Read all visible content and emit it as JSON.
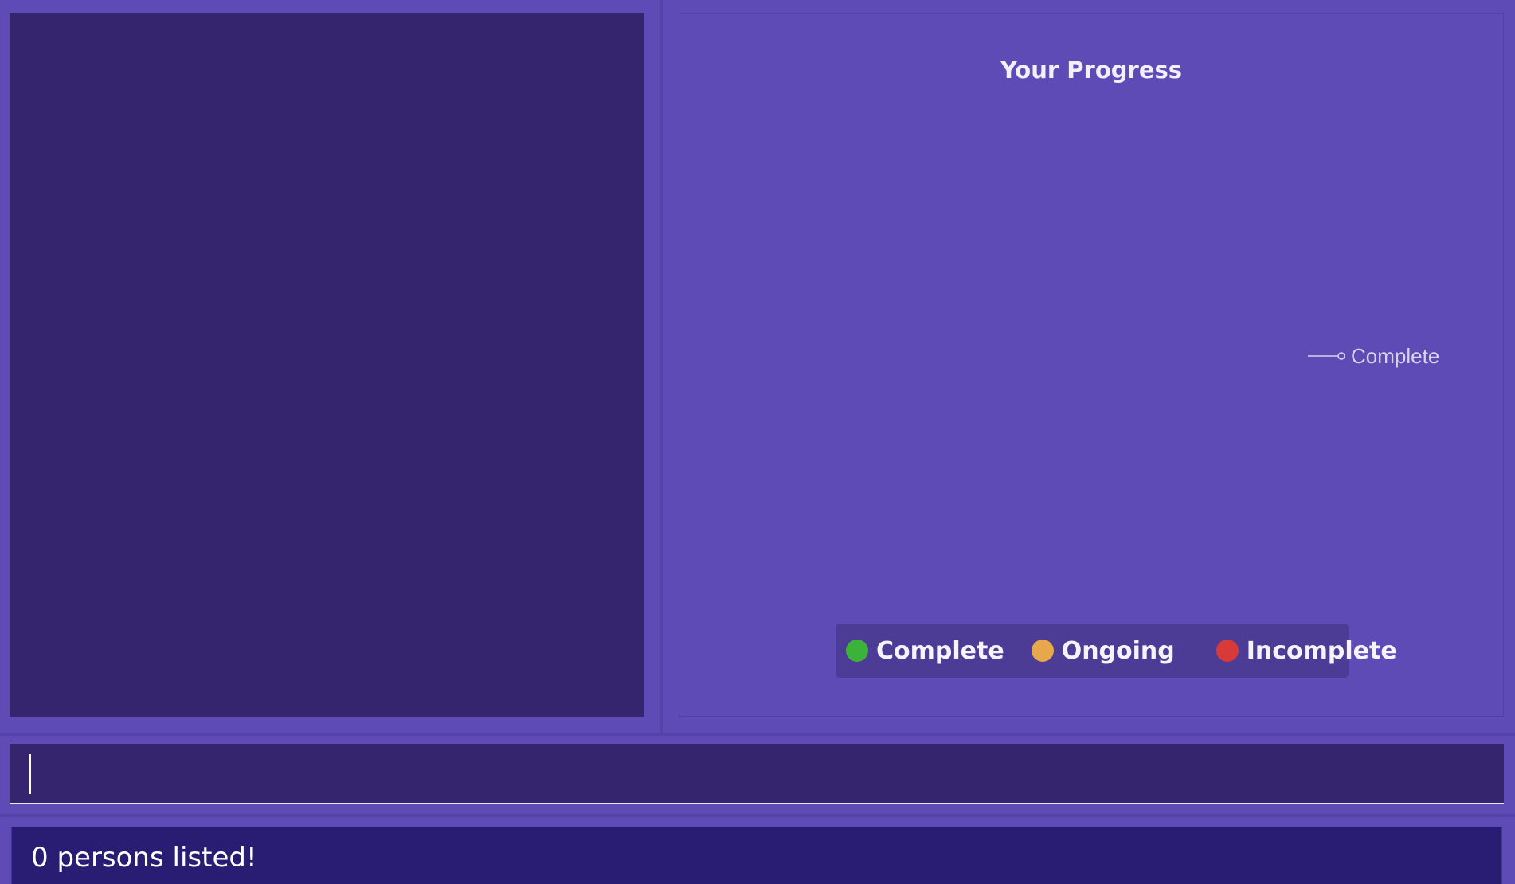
{
  "chart": {
    "title": "Your Progress",
    "pie_label": "Complete",
    "legend": [
      {
        "label": "Complete",
        "color": "#3bb33b"
      },
      {
        "label": "Ongoing",
        "color": "#e6a84b"
      },
      {
        "label": "Incomplete",
        "color": "#d83a3a"
      }
    ]
  },
  "chart_data": {
    "type": "pie",
    "title": "Your Progress",
    "categories": [
      "Complete",
      "Ongoing",
      "Incomplete"
    ],
    "values": [
      0,
      0,
      0
    ],
    "legend_position": "bottom"
  },
  "command_box": {
    "value": ""
  },
  "result_display": {
    "text": "0 persons listed!"
  },
  "colors": {
    "background": "#5f4bb6",
    "panel": "#35246e",
    "result_bg": "#291c73"
  }
}
